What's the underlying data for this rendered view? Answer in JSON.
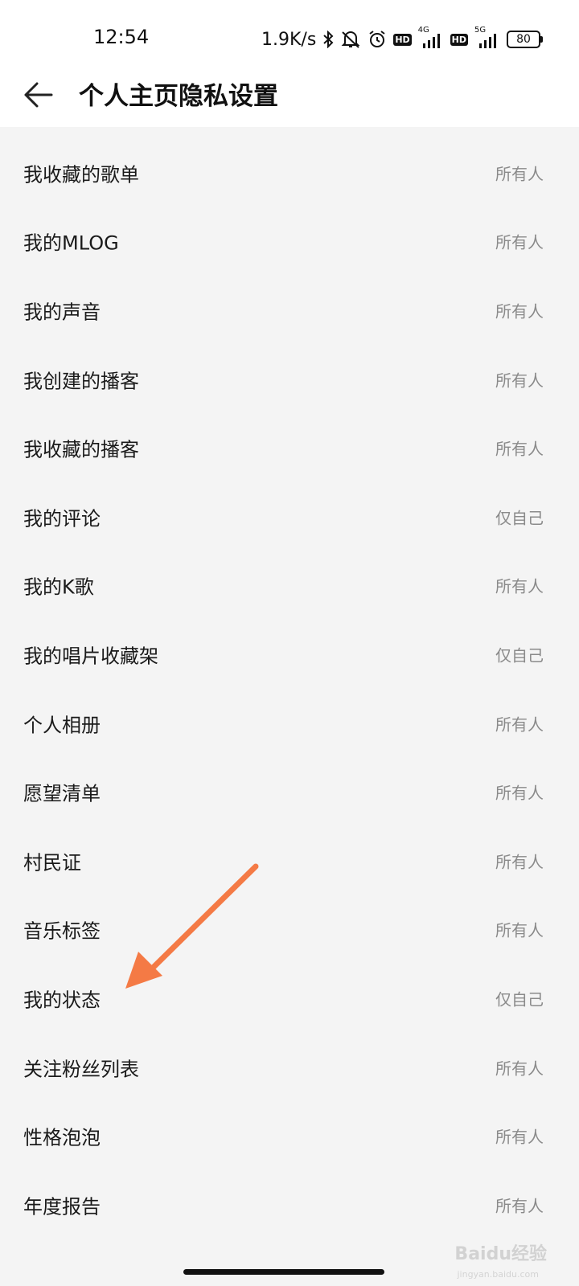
{
  "status_bar": {
    "time": "12:54",
    "net_speed": "1.9K/s",
    "hd_label": "HD",
    "net1": "4G",
    "net2": "5G",
    "battery": "80"
  },
  "header": {
    "title": "个人主页隐私设置"
  },
  "rows": [
    {
      "label": "我收藏的歌单",
      "value": "所有人"
    },
    {
      "label": "我的MLOG",
      "value": "所有人"
    },
    {
      "label": "我的声音",
      "value": "所有人"
    },
    {
      "label": "我创建的播客",
      "value": "所有人"
    },
    {
      "label": "我收藏的播客",
      "value": "所有人"
    },
    {
      "label": "我的评论",
      "value": "仅自己"
    },
    {
      "label": "我的K歌",
      "value": "所有人"
    },
    {
      "label": "我的唱片收藏架",
      "value": "仅自己"
    },
    {
      "label": "个人相册",
      "value": "所有人"
    },
    {
      "label": "愿望清单",
      "value": "所有人"
    },
    {
      "label": "村民证",
      "value": "所有人"
    },
    {
      "label": "音乐标签",
      "value": "所有人"
    },
    {
      "label": "我的状态",
      "value": "仅自己"
    },
    {
      "label": "关注粉丝列表",
      "value": "所有人"
    },
    {
      "label": "性格泡泡",
      "value": "所有人"
    },
    {
      "label": "年度报告",
      "value": "所有人"
    }
  ],
  "annotation": {
    "arrow_color": "#f47a45"
  },
  "watermark": {
    "main": "Baidu经验",
    "sub": "jingyan.baidu.com"
  }
}
